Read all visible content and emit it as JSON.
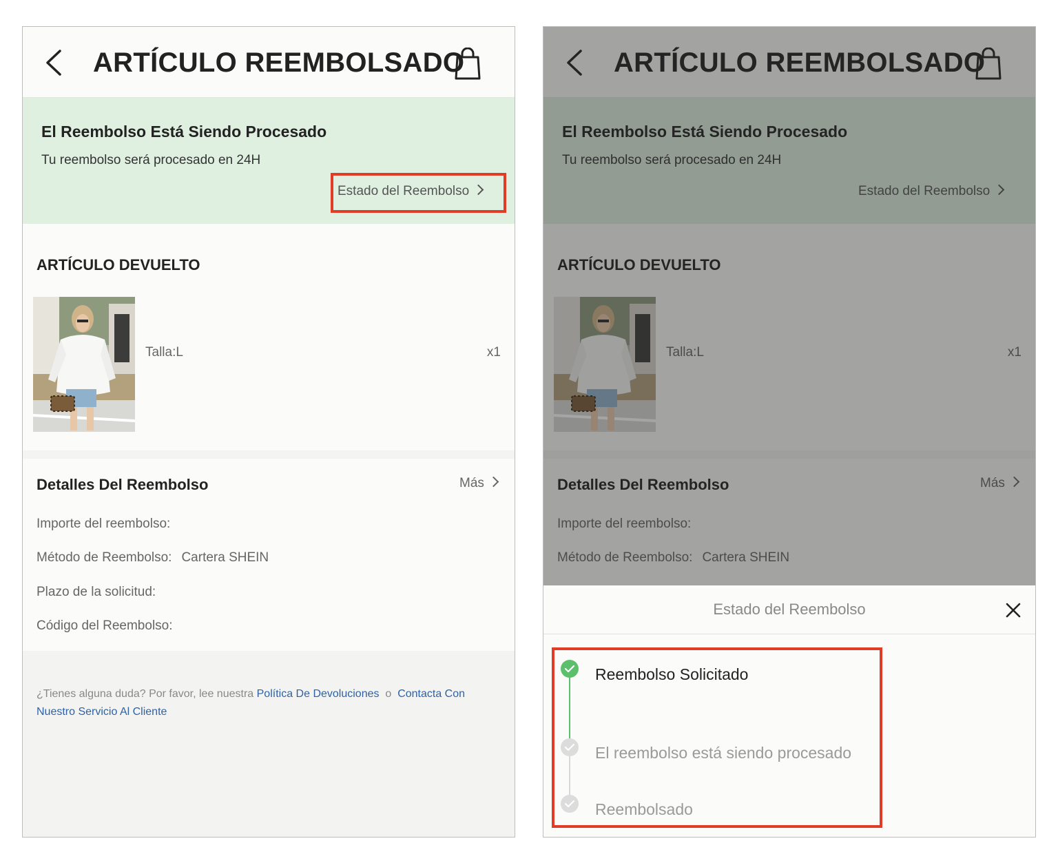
{
  "header": {
    "title": "ARTÍCULO REEMBOLSADO"
  },
  "banner": {
    "title": "El Reembolso Está Siendo Procesado",
    "subtitle": "Tu reembolso será procesado en 24H",
    "status_link": "Estado del Reembolso"
  },
  "returned_item": {
    "section_title": "ARTÍCULO DEVUELTO",
    "size": "Talla:L",
    "quantity": "x1"
  },
  "refund_details": {
    "title": "Detalles Del Reembolso",
    "more": "Más",
    "amount_label": "Importe del reembolso:",
    "method_label": "Método de Reembolso:",
    "method_value": "Cartera SHEIN",
    "deadline_label": "Plazo de la solicitud:",
    "code_label": "Código del Reembolso:"
  },
  "footer": {
    "question": "¿Tienes alguna duda? Por favor, lee nuestra",
    "policy_link": "Política De Devoluciones",
    "or": "o",
    "contact_link_1": "Contacta Con",
    "contact_link_2": "Nuestro Servicio Al Cliente"
  },
  "status_sheet": {
    "title": "Estado del Reembolso",
    "steps": [
      {
        "label": "Reembolso Solicitado",
        "done": true
      },
      {
        "label": "El reembolso está siendo procesado",
        "done": false
      },
      {
        "label": "Reembolsado",
        "done": false
      }
    ]
  },
  "colors": {
    "banner_bg": "#dff0e1",
    "highlight": "#e23b28",
    "link": "#2e62a8",
    "step_done": "#5bbf6b",
    "step_pending": "#dcdcdc"
  }
}
